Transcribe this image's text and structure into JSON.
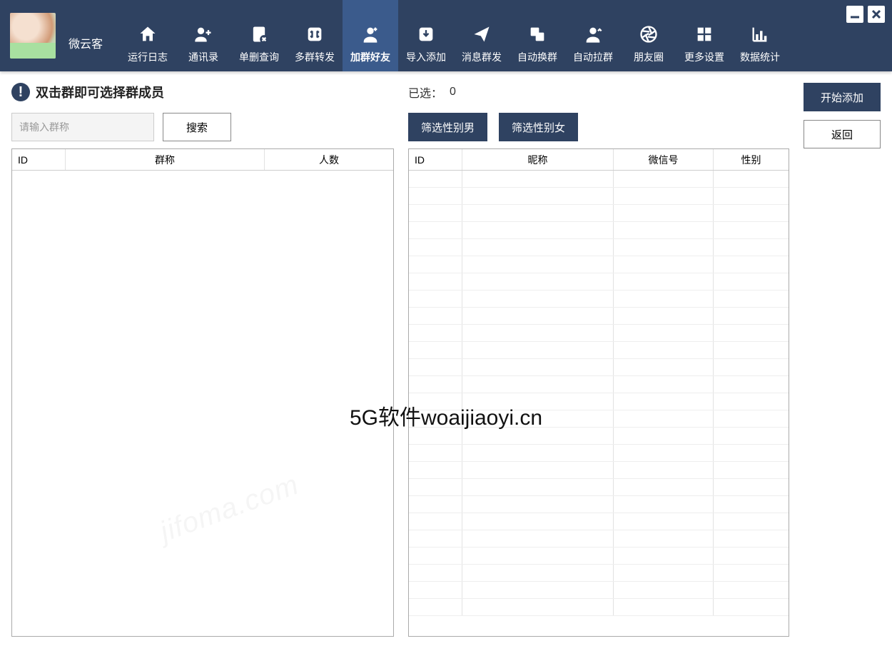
{
  "app_name": "微云客",
  "watermark": "5G软件woaijiaoyi.cn",
  "watermark2": "jifoma.com",
  "nav": [
    {
      "key": "log",
      "label": "运行日志",
      "icon": "home"
    },
    {
      "key": "contacts",
      "label": "通讯录",
      "icon": "person-plus"
    },
    {
      "key": "single-del",
      "label": "单删查询",
      "icon": "doc-x"
    },
    {
      "key": "multi-forward",
      "label": "多群转发",
      "icon": "swap"
    },
    {
      "key": "add-group-friends",
      "label": "加群好友",
      "icon": "person-add",
      "active": true
    },
    {
      "key": "import",
      "label": "导入添加",
      "icon": "import"
    },
    {
      "key": "mass-msg",
      "label": "消息群发",
      "icon": "send"
    },
    {
      "key": "auto-switch",
      "label": "自动换群",
      "icon": "copy"
    },
    {
      "key": "auto-add",
      "label": "自动拉群",
      "icon": "person-up"
    },
    {
      "key": "moments",
      "label": "朋友圈",
      "icon": "aperture"
    },
    {
      "key": "settings",
      "label": "更多设置",
      "icon": "grid"
    },
    {
      "key": "stats",
      "label": "数据统计",
      "icon": "bars"
    }
  ],
  "left": {
    "hint": "双击群即可选择群成员",
    "search_placeholder": "请输入群称",
    "search_button": "搜索",
    "columns": [
      "ID",
      "群称",
      "人数"
    ]
  },
  "mid": {
    "selected_label": "已选：",
    "selected_count": "0",
    "filter_male": "筛选性别男",
    "filter_female": "筛选性别女",
    "columns": [
      "ID",
      "昵称",
      "微信号",
      "性别"
    ]
  },
  "right": {
    "start": "开始添加",
    "back": "返回"
  }
}
